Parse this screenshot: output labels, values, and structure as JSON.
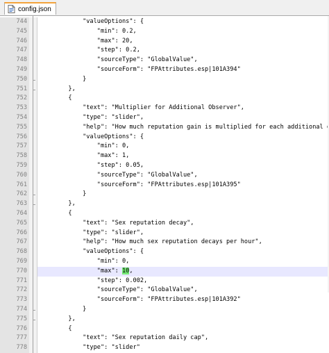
{
  "tab": {
    "label": "config.json",
    "icon": "file-icon",
    "accent": "#f3a33b"
  },
  "editor": {
    "highlight_color": "#74e874",
    "current_line_color": "#e8e8ff",
    "lines": [
      {
        "num": "744",
        "text": "            \"valueOptions\": {"
      },
      {
        "num": "745",
        "text": "                \"min\": 0.2,"
      },
      {
        "num": "746",
        "text": "                \"max\": 20,"
      },
      {
        "num": "747",
        "text": "                \"step\": 0.2,"
      },
      {
        "num": "748",
        "text": "                \"sourceType\": \"GlobalValue\","
      },
      {
        "num": "749",
        "text": "                \"sourceForm\": \"FPAttributes.esp|101A394\""
      },
      {
        "num": "750",
        "text": "            }"
      },
      {
        "num": "751",
        "text": "        },"
      },
      {
        "num": "752",
        "text": "        {"
      },
      {
        "num": "753",
        "text": "            \"text\": \"Multiplier for Additional Observer\","
      },
      {
        "num": "754",
        "text": "            \"type\": \"slider\","
      },
      {
        "num": "755",
        "text": "            \"help\": \"How much reputation gain is multiplied for each additional obse"
      },
      {
        "num": "756",
        "text": "            \"valueOptions\": {"
      },
      {
        "num": "757",
        "text": "                \"min\": 0,"
      },
      {
        "num": "758",
        "text": "                \"max\": 1,"
      },
      {
        "num": "759",
        "text": "                \"step\": 0.05,"
      },
      {
        "num": "760",
        "text": "                \"sourceType\": \"GlobalValue\","
      },
      {
        "num": "761",
        "text": "                \"sourceForm\": \"FPAttributes.esp|101A395\""
      },
      {
        "num": "762",
        "text": "            }"
      },
      {
        "num": "763",
        "text": "        },"
      },
      {
        "num": "764",
        "text": "        {"
      },
      {
        "num": "765",
        "text": "            \"text\": \"Sex reputation decay\","
      },
      {
        "num": "766",
        "text": "            \"type\": \"slider\","
      },
      {
        "num": "767",
        "text": "            \"help\": \"How much sex reputation decays per hour\","
      },
      {
        "num": "768",
        "text": "            \"valueOptions\": {"
      },
      {
        "num": "769",
        "text": "                \"min\": 0,"
      },
      {
        "num": "770",
        "pre": "                \"max\": ",
        "hl": "10",
        "post": ",",
        "current": true
      },
      {
        "num": "771",
        "text": "                \"step\": 0.002,"
      },
      {
        "num": "772",
        "text": "                \"sourceType\": \"GlobalValue\","
      },
      {
        "num": "773",
        "text": "                \"sourceForm\": \"FPAttributes.esp|101A392\""
      },
      {
        "num": "774",
        "text": "            }"
      },
      {
        "num": "775",
        "text": "        },"
      },
      {
        "num": "776",
        "text": "        {"
      },
      {
        "num": "777",
        "text": "            \"text\": \"Sex reputation daily cap\","
      },
      {
        "num": "778",
        "text": "            \"type\": \"slider\""
      }
    ]
  }
}
